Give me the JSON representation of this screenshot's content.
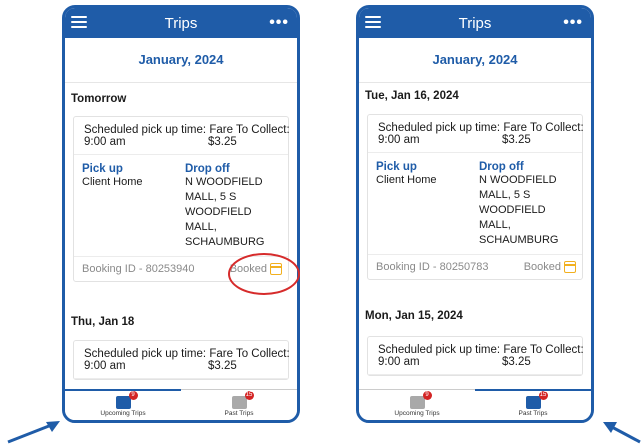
{
  "colors": {
    "brand": "#1f5ca8",
    "highlight": "#d62b2b",
    "booked_icon": "#f2b01e"
  },
  "left": {
    "header": {
      "title": "Trips",
      "menu_icon": "menu-icon",
      "more_icon": "more-icon"
    },
    "month": "January, 2024",
    "section1": "Tomorrow",
    "trip1": {
      "sched_label": "Scheduled pick up time:",
      "fare_label": "Fare To Collect:",
      "time": "9:00 am",
      "fare": "$3.25",
      "pickup_h": "Pick up",
      "pickup_v": "Client Home",
      "drop_h": "Drop off",
      "drop_v1": "N WOODFIELD",
      "drop_v2": "MALL, 5 S",
      "drop_v3": "WOODFIELD MALL,",
      "drop_v4": "SCHAUMBURG",
      "booking": "Booking ID - 80253940",
      "status": "Booked"
    },
    "section2": "Thu, Jan 18",
    "trip2": {
      "sched_label": "Scheduled pick up time:",
      "fare_label": "Fare To Collect:",
      "time": "9:00 am",
      "fare": "$3.25"
    },
    "tabs": [
      {
        "label": "Upcoming Trips",
        "badge": "9"
      },
      {
        "label": "Past Trips",
        "badge": "15"
      }
    ]
  },
  "right": {
    "header": {
      "title": "Trips"
    },
    "month": "January, 2024",
    "section1": "Tue, Jan 16, 2024",
    "trip1": {
      "sched_label": "Scheduled pick up time:",
      "fare_label": "Fare To Collect:",
      "time": "9:00 am",
      "fare": "$3.25",
      "pickup_h": "Pick up",
      "pickup_v": "Client Home",
      "drop_h": "Drop off",
      "drop_v1": "N WOODFIELD",
      "drop_v2": "MALL, 5 S",
      "drop_v3": "WOODFIELD MALL,",
      "drop_v4": "SCHAUMBURG",
      "booking": "Booking ID - 80250783",
      "status": "Booked"
    },
    "section2": "Mon, Jan 15, 2024",
    "trip2": {
      "sched_label": "Scheduled pick up time:",
      "fare_label": "Fare To Collect:",
      "time": "9:00 am",
      "fare": "$3.25"
    },
    "tabs": [
      {
        "label": "Upcoming Trips",
        "badge": "9"
      },
      {
        "label": "Past Trips",
        "badge": "15"
      }
    ]
  }
}
